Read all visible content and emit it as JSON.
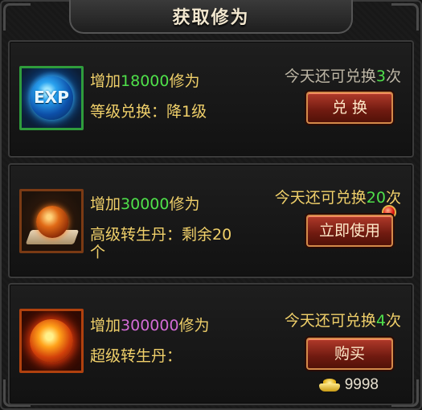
{
  "title": "获取修为",
  "items": [
    {
      "prefix": "增加",
      "amount": "18000",
      "suffix": "修为",
      "desc": "等级兑换：降1级",
      "quota_prefix": "今天还可兑换",
      "quota_count": "3",
      "quota_suffix": "次",
      "button_label": "兑 换"
    },
    {
      "prefix": "增加",
      "amount": "30000",
      "suffix": "修为",
      "desc": "高级转生丹：剩余20个",
      "quota_prefix": "今天还可兑换",
      "quota_count": "20",
      "quota_suffix": "次",
      "button_label": "立即使用"
    },
    {
      "prefix": "增加",
      "amount": "300000",
      "suffix": "修为",
      "desc": "超级转生丹：",
      "quota_prefix": "今天还可兑换",
      "quota_count": "4",
      "quota_suffix": "次",
      "button_label": "购买",
      "gold_amount": "9998"
    }
  ],
  "icons": {
    "exp_label": "EXP",
    "item1": "exp-orb-icon",
    "item2": "advanced-rebirth-pill-icon",
    "item3": "super-rebirth-pill-icon",
    "currency": "gold-ingot-icon"
  },
  "colors": {
    "amount_green": "#4fe04a",
    "amount_purple": "#d46bd6",
    "text_gold": "#f0d06a",
    "button_red": "#8a2416"
  }
}
